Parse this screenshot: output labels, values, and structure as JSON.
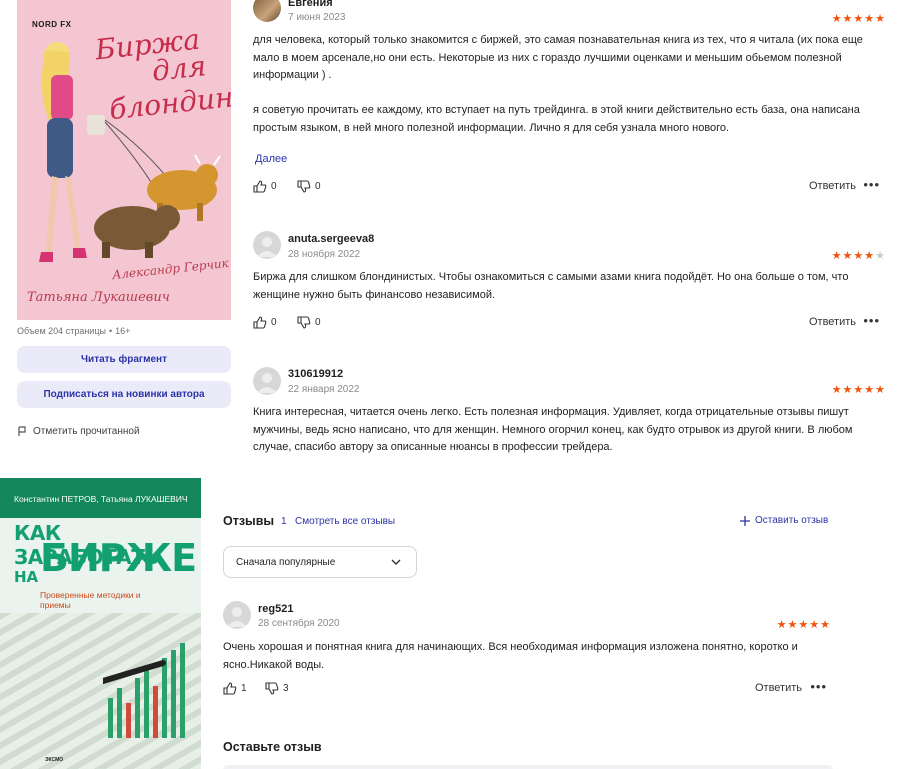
{
  "top_book": {
    "cover": {
      "publisher": "NORD FX",
      "title_lines": [
        "Биржа",
        "для",
        "блондинок"
      ],
      "author_a": "Александр Герчик",
      "author_b": "Татьяна Лукашевич"
    },
    "meta": {
      "volume": "Объем 204 страницы",
      "age": "16+"
    },
    "read_fragment": "Читать фрагмент",
    "subscribe_author": "Подписаться на новинки автора",
    "mark_read": "Отметить прочитанной"
  },
  "top_reviews": [
    {
      "name": "Евгения",
      "date": "7 июня 2023",
      "rating": 5,
      "text": "для человека, который только знакомится с биржей, это самая познавательная книга из тех, что я читала (их пока еще мало в моем арсенале,но они есть. Некоторые из них с гораздо лучшими оценками и меньшим обьемом полезной информации ) .\n\nя советую прочитать ее каждому, кто вступает на путь трейдинга. в этой книги действительно есть база, она написана простым языком, в ней много полезной информации. Лично я для себя узнала много нового.",
      "more": "Далее",
      "likes": "0",
      "dislikes": "0",
      "reply": "Ответить"
    },
    {
      "name": "anuta.sergeeva8",
      "date": "28 ноября 2022",
      "rating": 4,
      "text": "Биржа для слишком блондинистых. Чтобы ознакомиться с самыми азами книга подойдёт. Но она больше о том, что женщине нужно быть финансово независимой.",
      "likes": "0",
      "dislikes": "0",
      "reply": "Ответить"
    },
    {
      "name": "310619912",
      "date": "22 января 2022",
      "rating": 5,
      "text": "Книга интересная, читается очень легко. Есть полезная информация. Удивляет, когда отрицательные отзывы пишут мужчины, ведь ясно написано, что для женщин. Немного огорчил конец, как будто отрывок из другой книги. В любом случае, спасибо автору за описанные нюансы в профессии трейдера."
    }
  ],
  "bottom_book": {
    "cover": {
      "authors": "Константин ПЕТРОВ, Татьяна ЛУКАШЕВИЧ",
      "title_line1": "КАК ЗАРАБОТАТЬ",
      "title_line2_small": "НА",
      "title_line2_big": "БИРЖЕ",
      "subtitle": "Проверенные методики и приемы",
      "publisher": "ЭКСМО"
    }
  },
  "reviews_section": {
    "title": "Отзывы",
    "count": "1",
    "see_all": "Смотреть все отзывы",
    "leave_review": "Оставить отзыв",
    "sort_value": "Сначала популярные",
    "review": {
      "name": "reg521",
      "date": "28 сентября 2020",
      "rating": 5,
      "text": "Очень хорошая и понятная книга для начинающих. Вся необходимая информация изложена понятно, коротко и ясно.Никакой воды.",
      "likes": "1",
      "dislikes": "3",
      "reply": "Ответить"
    },
    "leave_title": "Оставьте отзыв"
  },
  "colors": {
    "accent": "#2b34a8",
    "star": "#f2530b",
    "pill_bg": "#ebeaf8"
  }
}
